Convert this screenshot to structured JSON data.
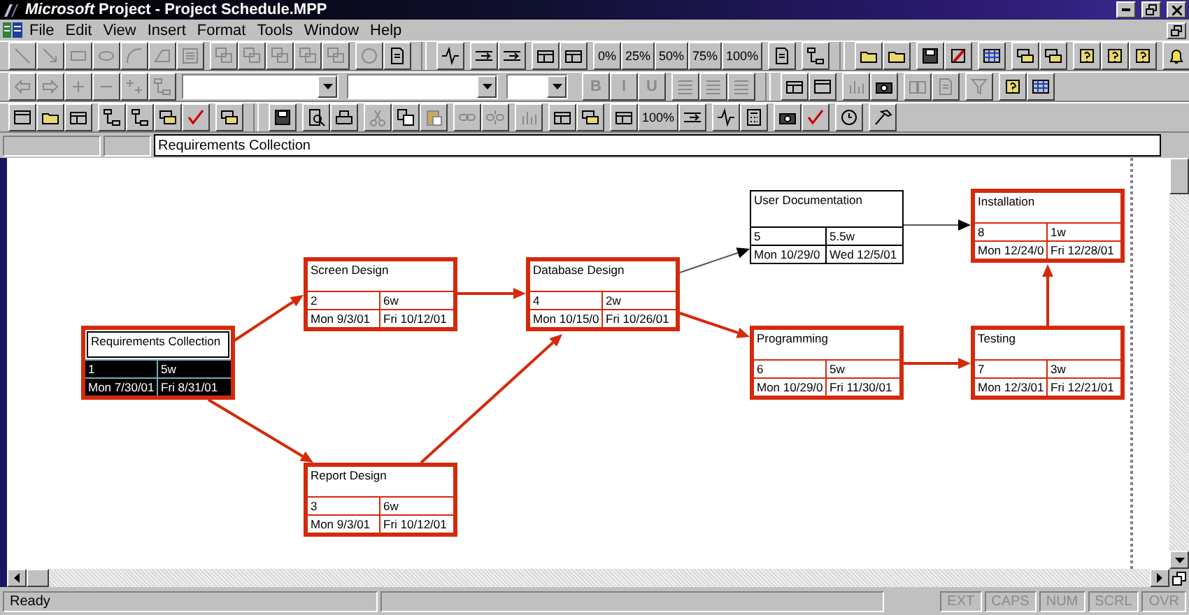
{
  "window": {
    "title": "*Microsoft* Project - Project Schedule.MPP"
  },
  "menu": [
    "File",
    "Edit",
    "View",
    "Insert",
    "Format",
    "Tools",
    "Window",
    "Help"
  ],
  "toolbars": [
    {
      "groups": [
        {
          "items": [
            {
              "kind": "icon",
              "disabled": true
            },
            {
              "kind": "icon",
              "disabled": true
            },
            {
              "kind": "icon",
              "disabled": true
            },
            {
              "kind": "icon",
              "disabled": true
            },
            {
              "kind": "icon",
              "disabled": true
            },
            {
              "kind": "icon",
              "disabled": true
            },
            {
              "kind": "icon",
              "disabled": true
            }
          ]
        },
        {
          "items": [
            {
              "kind": "icon",
              "disabled": true
            },
            {
              "kind": "icon",
              "disabled": true
            },
            {
              "kind": "icon",
              "disabled": true
            },
            {
              "kind": "icon",
              "disabled": true
            },
            {
              "kind": "icon",
              "disabled": true
            }
          ]
        },
        {
          "items": [
            {
              "kind": "icon",
              "disabled": true
            },
            {
              "kind": "icon",
              "disabled": false
            }
          ]
        },
        {
          "items": [
            {
              "kind": "separator"
            }
          ]
        },
        {
          "items": [
            {
              "kind": "icon",
              "disabled": false
            }
          ]
        },
        {
          "items": [
            {
              "kind": "icon",
              "disabled": false
            },
            {
              "kind": "icon",
              "disabled": false
            }
          ]
        },
        {
          "items": [
            {
              "kind": "icon",
              "disabled": false
            },
            {
              "kind": "icon",
              "disabled": false
            }
          ]
        },
        {
          "items": [
            {
              "kind": "text",
              "label": "0%",
              "disabled": false
            },
            {
              "kind": "text",
              "label": "25%",
              "disabled": false
            },
            {
              "kind": "text",
              "label": "50%",
              "disabled": false
            },
            {
              "kind": "text",
              "label": "75%",
              "disabled": false
            },
            {
              "kind": "text",
              "label": "100%",
              "disabled": false
            }
          ]
        },
        {
          "items": [
            {
              "kind": "icon",
              "disabled": false
            }
          ]
        },
        {
          "items": [
            {
              "kind": "icon",
              "disabled": false
            }
          ]
        },
        {
          "items": [
            {
              "kind": "separator"
            }
          ]
        },
        {
          "items": [
            {
              "kind": "icon",
              "disabled": false
            },
            {
              "kind": "icon",
              "disabled": false
            }
          ]
        },
        {
          "items": [
            {
              "kind": "icon",
              "disabled": false
            },
            {
              "kind": "icon",
              "disabled": false
            }
          ]
        },
        {
          "items": [
            {
              "kind": "icon",
              "disabled": false
            }
          ]
        },
        {
          "items": [
            {
              "kind": "icon",
              "disabled": false
            },
            {
              "kind": "icon",
              "disabled": false
            }
          ]
        },
        {
          "items": [
            {
              "kind": "icon",
              "disabled": false
            },
            {
              "kind": "icon",
              "disabled": false
            },
            {
              "kind": "icon",
              "disabled": false
            }
          ]
        },
        {
          "items": [
            {
              "kind": "icon",
              "disabled": false
            }
          ]
        }
      ]
    },
    {
      "groups": [
        {
          "items": [
            {
              "kind": "icon",
              "disabled": true
            },
            {
              "kind": "icon",
              "disabled": true
            },
            {
              "kind": "icon",
              "disabled": true
            },
            {
              "kind": "icon",
              "disabled": true
            },
            {
              "kind": "icon",
              "disabled": true
            },
            {
              "kind": "icon",
              "disabled": true
            }
          ]
        },
        {
          "items": [
            {
              "kind": "combo"
            },
            {
              "kind": "combo"
            },
            {
              "kind": "combo"
            }
          ]
        },
        {
          "items": [
            {
              "kind": "text",
              "label": "B",
              "disabled": true
            },
            {
              "kind": "text",
              "label": "I",
              "disabled": true
            },
            {
              "kind": "text",
              "label": "U",
              "disabled": true
            }
          ]
        },
        {
          "items": [
            {
              "kind": "icon",
              "disabled": true
            },
            {
              "kind": "icon",
              "disabled": true
            },
            {
              "kind": "icon",
              "disabled": true
            }
          ]
        },
        {
          "items": [
            {
              "kind": "separator"
            }
          ]
        },
        {
          "items": [
            {
              "kind": "icon",
              "disabled": false
            },
            {
              "kind": "icon",
              "disabled": false
            }
          ]
        },
        {
          "items": [
            {
              "kind": "icon",
              "disabled": true
            },
            {
              "kind": "icon",
              "disabled": false
            }
          ]
        },
        {
          "items": [
            {
              "kind": "icon",
              "disabled": true
            },
            {
              "kind": "icon",
              "disabled": true
            }
          ]
        },
        {
          "items": [
            {
              "kind": "icon",
              "disabled": true
            }
          ]
        },
        {
          "items": [
            {
              "kind": "icon",
              "disabled": false
            },
            {
              "kind": "icon",
              "disabled": false
            }
          ]
        }
      ]
    },
    {
      "groups": [
        {
          "items": [
            {
              "kind": "icon",
              "disabled": false
            },
            {
              "kind": "icon",
              "disabled": false
            },
            {
              "kind": "icon",
              "disabled": false
            }
          ]
        },
        {
          "items": [
            {
              "kind": "icon",
              "disabled": false
            },
            {
              "kind": "icon",
              "disabled": false
            },
            {
              "kind": "icon",
              "disabled": false
            },
            {
              "kind": "icon",
              "disabled": false
            }
          ]
        },
        {
          "items": [
            {
              "kind": "icon",
              "disabled": false
            }
          ]
        },
        {
          "items": [
            {
              "kind": "separator"
            }
          ]
        },
        {
          "items": [
            {
              "kind": "icon",
              "disabled": false
            }
          ]
        },
        {
          "items": [
            {
              "kind": "icon",
              "disabled": false
            },
            {
              "kind": "icon",
              "disabled": false
            }
          ]
        },
        {
          "items": [
            {
              "kind": "icon",
              "disabled": true
            },
            {
              "kind": "icon",
              "disabled": false
            },
            {
              "kind": "icon",
              "disabled": true
            }
          ]
        },
        {
          "items": [
            {
              "kind": "icon",
              "disabled": true
            },
            {
              "kind": "icon",
              "disabled": true
            }
          ]
        },
        {
          "items": [
            {
              "kind": "icon",
              "disabled": true
            }
          ]
        },
        {
          "items": [
            {
              "kind": "icon",
              "disabled": false
            },
            {
              "kind": "icon",
              "disabled": false
            }
          ]
        },
        {
          "items": [
            {
              "kind": "icon",
              "disabled": false
            },
            {
              "kind": "text",
              "label": "100%",
              "disabled": false
            },
            {
              "kind": "icon",
              "disabled": false
            }
          ]
        },
        {
          "items": [
            {
              "kind": "icon",
              "disabled": false
            },
            {
              "kind": "icon",
              "disabled": false
            }
          ]
        },
        {
          "items": [
            {
              "kind": "icon",
              "disabled": false
            },
            {
              "kind": "icon",
              "disabled": false
            }
          ]
        },
        {
          "items": [
            {
              "kind": "icon",
              "disabled": false
            }
          ]
        },
        {
          "items": [
            {
              "kind": "icon",
              "disabled": false
            }
          ]
        }
      ]
    }
  ],
  "entry_bar": {
    "value": "Requirements Collection"
  },
  "nodes": [
    {
      "name": "Requirements Collection",
      "id": "1",
      "duration": "5w",
      "start": "Mon 7/30/01",
      "finish": "Fri 8/31/01",
      "critical": true,
      "selected": true
    },
    {
      "name": "Screen Design",
      "id": "2",
      "duration": "6w",
      "start": "Mon 9/3/01",
      "finish": "Fri 10/12/01",
      "critical": true,
      "selected": false
    },
    {
      "name": "Report Design",
      "id": "3",
      "duration": "6w",
      "start": "Mon 9/3/01",
      "finish": "Fri 10/12/01",
      "critical": true,
      "selected": false
    },
    {
      "name": "Database Design",
      "id": "4",
      "duration": "2w",
      "start": "Mon 10/15/0",
      "finish": "Fri 10/26/01",
      "critical": true,
      "selected": false
    },
    {
      "name": "User Documentation",
      "id": "5",
      "duration": "5.5w",
      "start": "Mon 10/29/0",
      "finish": "Wed 12/5/01",
      "critical": false,
      "selected": false
    },
    {
      "name": "Programming",
      "id": "6",
      "duration": "5w",
      "start": "Mon 10/29/0",
      "finish": "Fri 11/30/01",
      "critical": true,
      "selected": false
    },
    {
      "name": "Installation",
      "id": "8",
      "duration": "1w",
      "start": "Mon 12/24/0",
      "finish": "Fri 12/28/01",
      "critical": true,
      "selected": false
    },
    {
      "name": "Testing",
      "id": "7",
      "duration": "3w",
      "start": "Mon 12/3/01",
      "finish": "Fri 12/21/01",
      "critical": true,
      "selected": false
    }
  ],
  "links": [
    {
      "critical": true
    },
    {
      "critical": true
    },
    {
      "critical": true
    },
    {
      "critical": true
    },
    {
      "critical": false
    },
    {
      "critical": true
    },
    {
      "critical": false
    },
    {
      "critical": true
    },
    {
      "critical": true
    }
  ],
  "status_bar": {
    "message": "Ready",
    "indicators": [
      {
        "label": "EXT",
        "on": false
      },
      {
        "label": "CAPS",
        "on": false
      },
      {
        "label": "NUM",
        "on": false
      },
      {
        "label": "SCRL",
        "on": false
      },
      {
        "label": "OVR",
        "on": false
      }
    ]
  }
}
